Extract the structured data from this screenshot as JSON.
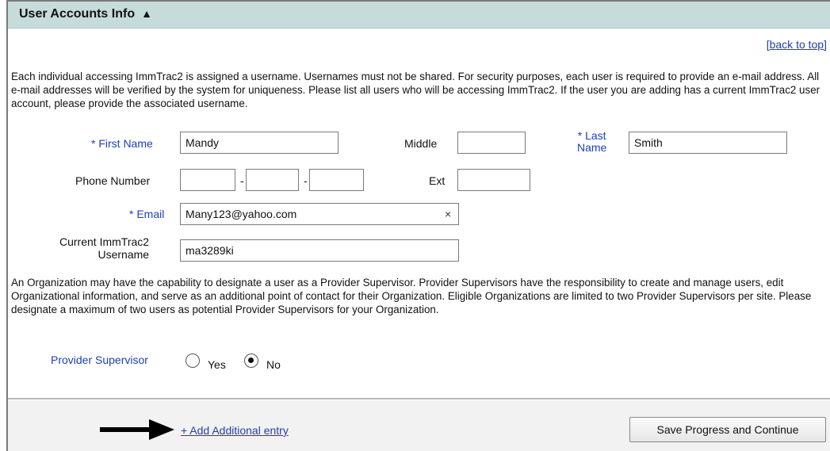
{
  "section": {
    "title": "User Accounts Info",
    "collapse_icon": "▲",
    "back_to_top": "[back to top]"
  },
  "intro_text": "Each individual accessing ImmTrac2 is assigned a username. Usernames must not be shared. For security purposes, each user is required to provide an e-mail address. All e-mail addresses will be verified by the system for uniqueness. Please list all users who will be accessing ImmTrac2. If the user you are adding has a current ImmTrac2 user account, please provide the associated username.",
  "form": {
    "required_mark": "*",
    "first_name_label": "First Name",
    "first_name_value": "Mandy",
    "middle_label": "Middle",
    "middle_value": "",
    "last_name_label_line1": "Last",
    "last_name_label_line2": "Name",
    "last_name_value": "Smith",
    "phone_label": "Phone Number",
    "phone_area": "",
    "phone_prefix": "",
    "phone_line": "",
    "phone_separator": "-",
    "ext_label": "Ext",
    "ext_value": "",
    "email_label": "Email",
    "email_value": "Many123@yahoo.com",
    "email_clear": "×",
    "username_label_line1": "Current ImmTrac2",
    "username_label_line2": "Username",
    "username_value": "ma3289ki"
  },
  "supervisor_text": "An Organization may have the capability to designate a user as a Provider Supervisor. Provider Supervisors have the responsibility to create and manage users, edit Organizational information, and serve as an additional point of contact for their Organization. Eligible Organizations are limited to two Provider Supervisors per site. Please designate a maximum of two users as potential Provider Supervisors for your Organization.",
  "supervisor": {
    "label": "Provider Supervisor",
    "yes_label": "Yes",
    "no_label": "No",
    "selected": "No"
  },
  "footer": {
    "add_entry_link": "+ Add Additional entry",
    "save_button": "Save Progress and Continue"
  },
  "colors": {
    "header_bg": "#c6dcdb",
    "link": "#1f3fb5",
    "required": "#1f3fb5"
  }
}
